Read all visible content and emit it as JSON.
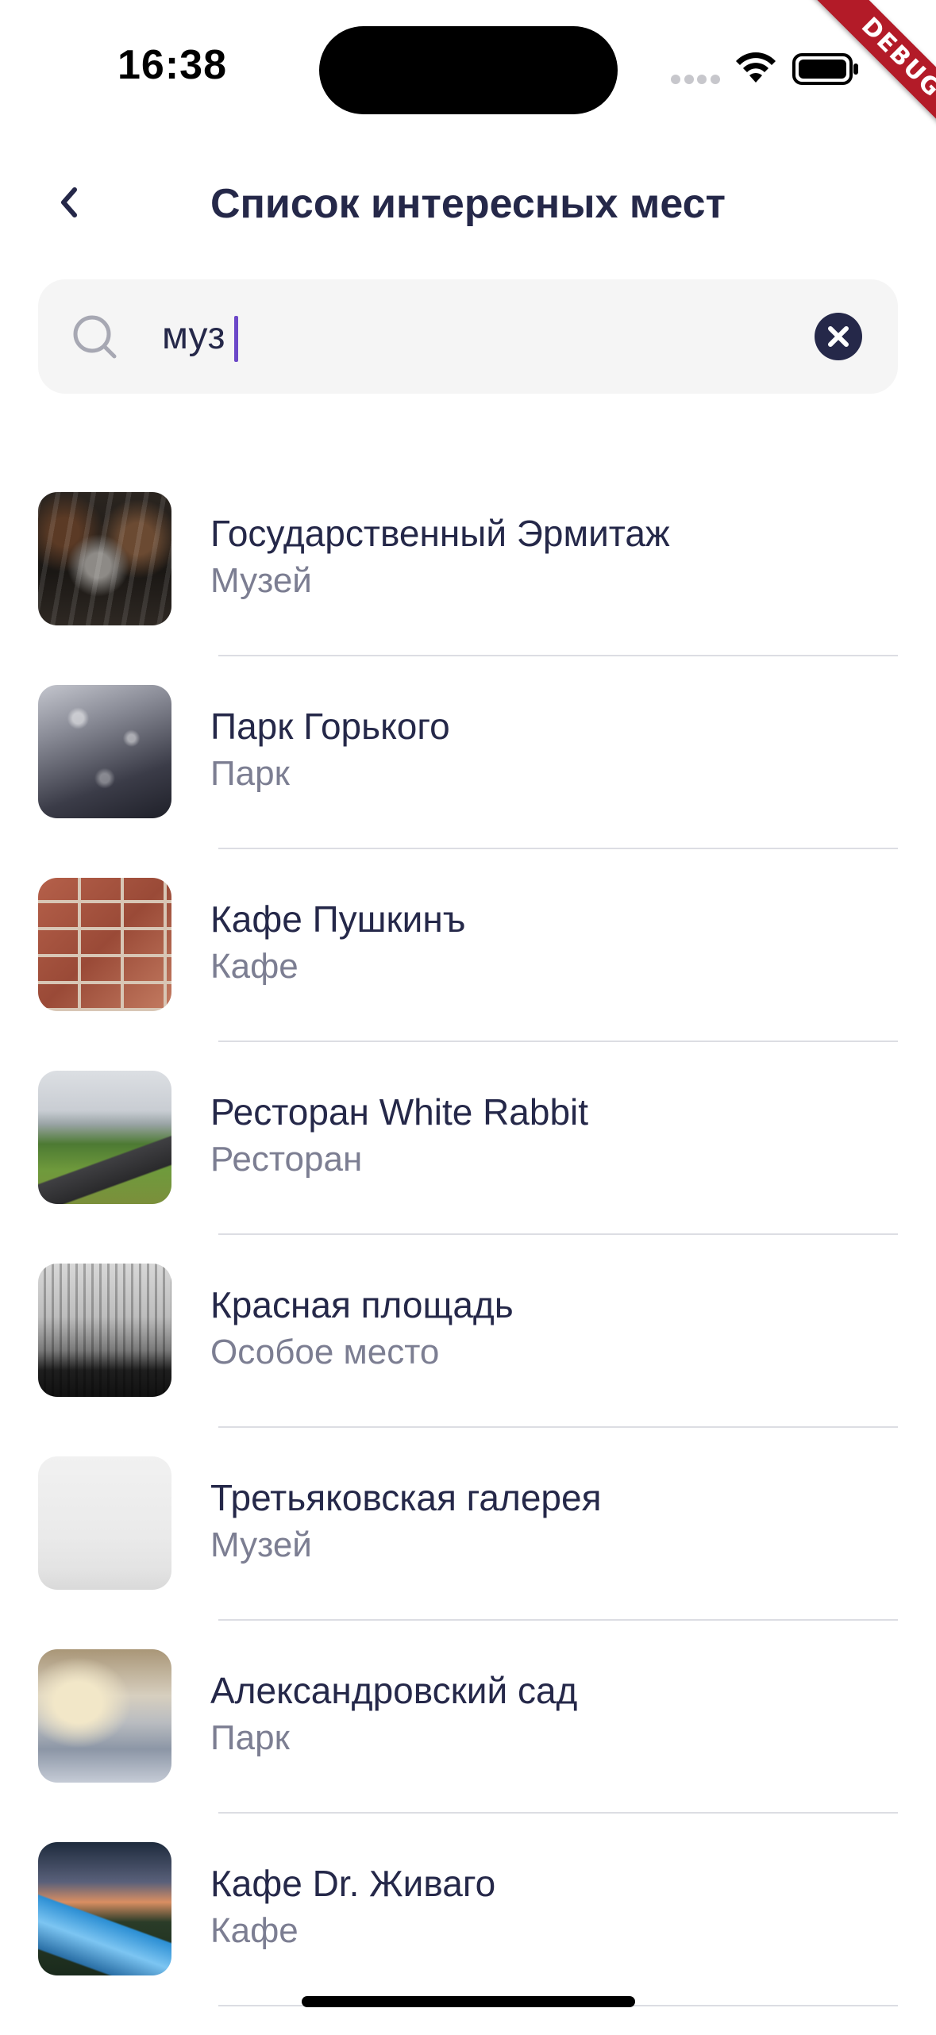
{
  "status_bar": {
    "time": "16:38",
    "wifi_icon": "wifi-icon",
    "battery_icon": "battery-icon",
    "debug_banner": "DEBUG"
  },
  "header": {
    "back_icon": "chevron-left-icon",
    "title": "Список интересных мест"
  },
  "search": {
    "value": "муз",
    "search_icon": "search-icon",
    "clear_icon": "clear-circle-icon"
  },
  "places": [
    {
      "name": "Государственный Эрмитаж",
      "type": "Музей"
    },
    {
      "name": "Парк Горького",
      "type": "Парк"
    },
    {
      "name": "Кафе Пушкинъ",
      "type": "Кафе"
    },
    {
      "name": "Ресторан White Rabbit",
      "type": "Ресторан"
    },
    {
      "name": "Красная площадь",
      "type": "Особое место"
    },
    {
      "name": "Третьяковская галерея",
      "type": "Музей"
    },
    {
      "name": "Александровский сад",
      "type": "Парк"
    },
    {
      "name": "Кафе Dr. Живаго",
      "type": "Кафе"
    }
  ],
  "colors": {
    "text_primary": "#252849",
    "text_secondary": "#7c7e92",
    "search_background": "#f5f5f5",
    "cursor_accent": "#6c48c8",
    "divider": "#dcdde3",
    "debug_banner": "#b31b28"
  }
}
